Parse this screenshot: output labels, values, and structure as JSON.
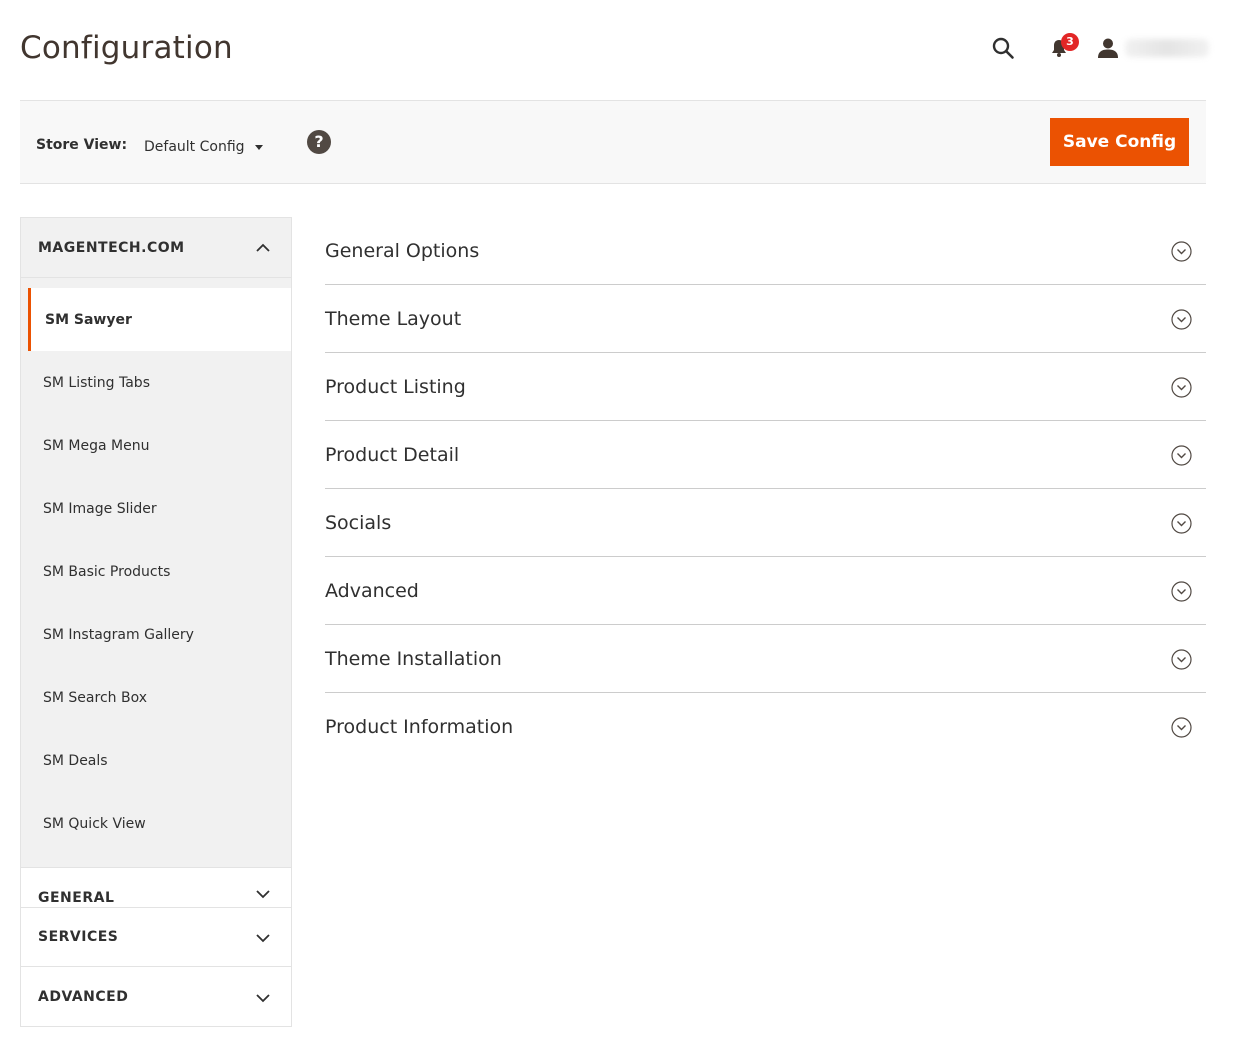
{
  "header": {
    "title": "Configuration",
    "notifications_count": "3",
    "search_icon": "search-icon",
    "bell_icon": "bell-icon",
    "user_icon": "user-icon"
  },
  "toolbar": {
    "store_view_label": "Store View:",
    "store_view_value": "Default Config",
    "help_icon": "?",
    "save_label": "Save Config"
  },
  "sidebar": {
    "open_group": {
      "title": "MAGENTECH.COM",
      "items": [
        {
          "label": "SM Sawyer",
          "active": true
        },
        {
          "label": "SM Listing Tabs"
        },
        {
          "label": "SM Mega Menu"
        },
        {
          "label": "SM Image Slider"
        },
        {
          "label": "SM Basic Products"
        },
        {
          "label": "SM Instagram Gallery"
        },
        {
          "label": "SM Search Box"
        },
        {
          "label": "SM Deals"
        },
        {
          "label": "SM Quick View"
        }
      ]
    },
    "collapsed_groups": [
      "GENERAL",
      "SERVICES",
      "ADVANCED"
    ]
  },
  "sections": [
    "General Options",
    "Theme Layout",
    "Product Listing",
    "Product Detail",
    "Socials",
    "Advanced",
    "Theme Installation",
    "Product Information"
  ],
  "colors": {
    "accent": "#eb5202",
    "badge": "#e22626",
    "sidebar_bg": "#f1f1f1",
    "toolbar_bg": "#f8f8f8",
    "text": "#303030"
  }
}
